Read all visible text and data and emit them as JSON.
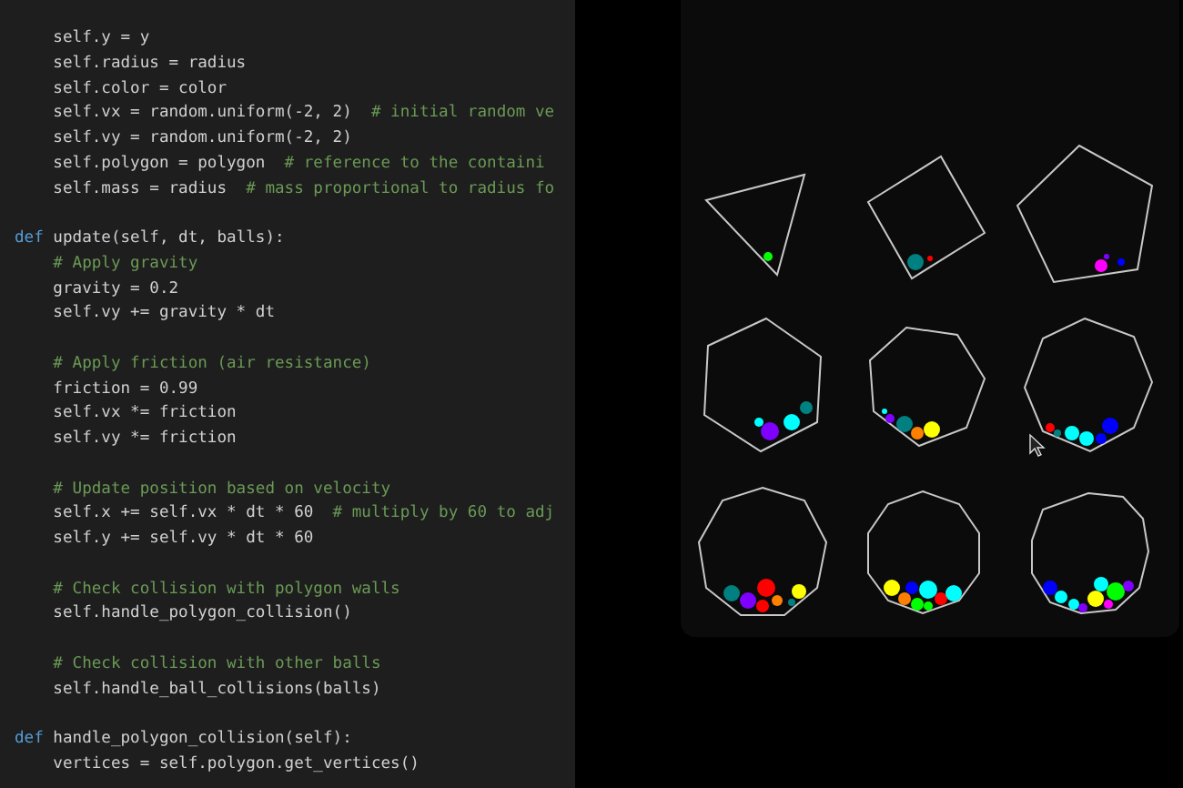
{
  "editor": {
    "lines": [
      {
        "kind": "code",
        "segments": [
          {
            "kind": "plain",
            "text": "    self.y = y"
          }
        ]
      },
      {
        "kind": "code",
        "segments": [
          {
            "kind": "plain",
            "text": "    self.radius = radius"
          }
        ]
      },
      {
        "kind": "code",
        "segments": [
          {
            "kind": "plain",
            "text": "    self.color = color"
          }
        ]
      },
      {
        "kind": "code",
        "segments": [
          {
            "kind": "plain",
            "text": "    self.vx = random.uniform(-2, 2)  "
          },
          {
            "kind": "comment",
            "text": "# initial random ve"
          }
        ]
      },
      {
        "kind": "code",
        "segments": [
          {
            "kind": "plain",
            "text": "    self.vy = random.uniform(-2, 2)"
          }
        ]
      },
      {
        "kind": "code",
        "segments": [
          {
            "kind": "plain",
            "text": "    self.polygon = polygon  "
          },
          {
            "kind": "comment",
            "text": "# reference to the containi"
          }
        ]
      },
      {
        "kind": "code",
        "segments": [
          {
            "kind": "plain",
            "text": "    self.mass = radius  "
          },
          {
            "kind": "comment",
            "text": "# mass proportional to radius fo"
          }
        ]
      },
      {
        "kind": "blank"
      },
      {
        "kind": "code",
        "segments": [
          {
            "kind": "keyword",
            "text": "def"
          },
          {
            "kind": "plain",
            "text": " update(self, dt, balls):"
          }
        ]
      },
      {
        "kind": "code",
        "segments": [
          {
            "kind": "comment",
            "text": "    # Apply gravity"
          }
        ]
      },
      {
        "kind": "code",
        "segments": [
          {
            "kind": "plain",
            "text": "    gravity = 0.2"
          }
        ]
      },
      {
        "kind": "code",
        "segments": [
          {
            "kind": "plain",
            "text": "    self.vy += gravity * dt"
          }
        ]
      },
      {
        "kind": "blank"
      },
      {
        "kind": "code",
        "segments": [
          {
            "kind": "comment",
            "text": "    # Apply friction (air resistance)"
          }
        ]
      },
      {
        "kind": "code",
        "segments": [
          {
            "kind": "plain",
            "text": "    friction = 0.99"
          }
        ]
      },
      {
        "kind": "code",
        "segments": [
          {
            "kind": "plain",
            "text": "    self.vx *= friction"
          }
        ]
      },
      {
        "kind": "code",
        "segments": [
          {
            "kind": "plain",
            "text": "    self.vy *= friction"
          }
        ]
      },
      {
        "kind": "blank"
      },
      {
        "kind": "code",
        "segments": [
          {
            "kind": "comment",
            "text": "    # Update position based on velocity"
          }
        ]
      },
      {
        "kind": "code",
        "segments": [
          {
            "kind": "plain",
            "text": "    self.x += self.vx * dt * 60  "
          },
          {
            "kind": "comment",
            "text": "# multiply by 60 to adj"
          }
        ]
      },
      {
        "kind": "code",
        "segments": [
          {
            "kind": "plain",
            "text": "    self.y += self.vy * dt * 60"
          }
        ]
      },
      {
        "kind": "blank"
      },
      {
        "kind": "code",
        "segments": [
          {
            "kind": "comment",
            "text": "    # Check collision with polygon walls"
          }
        ]
      },
      {
        "kind": "code",
        "segments": [
          {
            "kind": "plain",
            "text": "    self.handle_polygon_collision()"
          }
        ]
      },
      {
        "kind": "blank"
      },
      {
        "kind": "code",
        "segments": [
          {
            "kind": "comment",
            "text": "    # Check collision with other balls"
          }
        ]
      },
      {
        "kind": "code",
        "segments": [
          {
            "kind": "plain",
            "text": "    self.handle_ball_collisions(balls)"
          }
        ]
      },
      {
        "kind": "blank"
      },
      {
        "kind": "code",
        "segments": [
          {
            "kind": "keyword",
            "text": "def"
          },
          {
            "kind": "plain",
            "text": " handle_polygon_collision(self):"
          }
        ]
      },
      {
        "kind": "code",
        "segments": [
          {
            "kind": "plain",
            "text": "    vertices = self.polygon.get_vertices()"
          }
        ]
      }
    ]
  }
}
